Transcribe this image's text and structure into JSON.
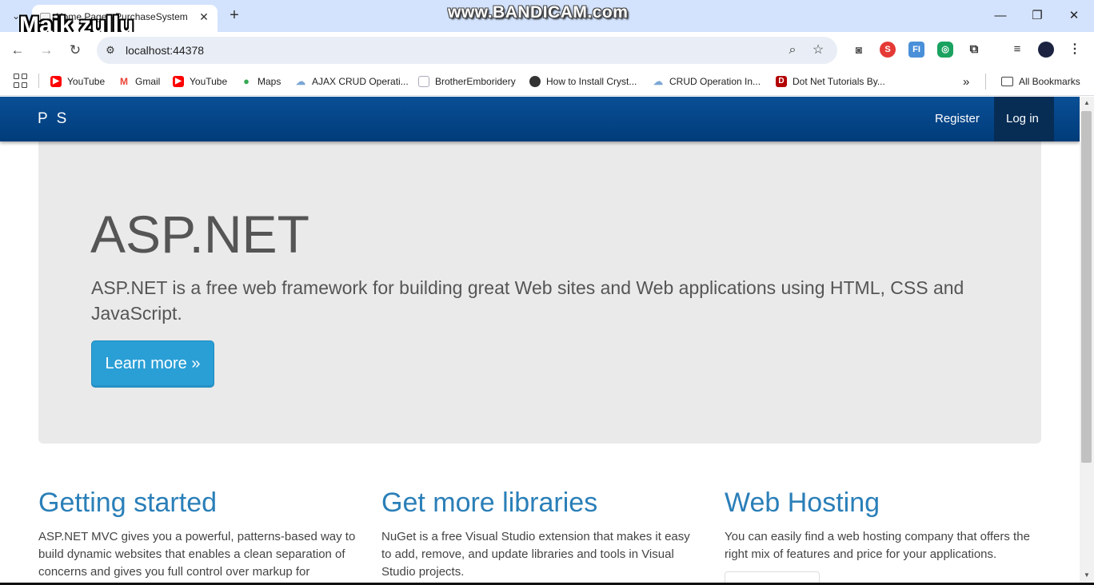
{
  "overlay": {
    "name": "Maik zullu",
    "watermark": "www.BANDICAM.com"
  },
  "browser": {
    "tab_title": "Home Page - PurchaseSystem",
    "url": "localhost:44378",
    "bookmarks": [
      {
        "label": "YouTube",
        "icon": "youtube-icon",
        "color": "#ff0000"
      },
      {
        "label": "Gmail",
        "icon": "gmail-icon",
        "color": "#ea4335"
      },
      {
        "label": "YouTube",
        "icon": "youtube-icon",
        "color": "#ff0000"
      },
      {
        "label": "Maps",
        "icon": "maps-icon",
        "color": "#34a853"
      },
      {
        "label": "AJAX CRUD Operati...",
        "icon": "cloud-icon",
        "color": "#7aa7d6"
      },
      {
        "label": "BrotherEmboridery",
        "icon": "page-icon",
        "color": "#8aa8c8"
      },
      {
        "label": "How to Install Cryst...",
        "icon": "globe-icon",
        "color": "#333333"
      },
      {
        "label": "CRUD Operation In...",
        "icon": "cloud-icon",
        "color": "#7aa7d6"
      },
      {
        "label": "Dot Net Tutorials By...",
        "icon": "dotnet-icon",
        "color": "#b30000"
      }
    ],
    "all_bookmarks": "All Bookmarks"
  },
  "site": {
    "brand": "P S",
    "nav": {
      "register": "Register",
      "login": "Log in"
    },
    "jumbotron": {
      "title": "ASP.NET",
      "lead": "ASP.NET is a free web framework for building great Web sites and Web applications using HTML, CSS and JavaScript.",
      "button": "Learn more »"
    },
    "columns": [
      {
        "title": "Getting started",
        "text": "ASP.NET MVC gives you a powerful, patterns-based way to build dynamic websites that enables a clean separation of concerns and gives you full control over markup for"
      },
      {
        "title": "Get more libraries",
        "text": "NuGet is a free Visual Studio extension that makes it easy to add, remove, and update libraries and tools in Visual Studio projects."
      },
      {
        "title": "Web Hosting",
        "text": "You can easily find a web hosting company that offers the right mix of features and price for your applications."
      }
    ]
  },
  "colors": {
    "navbar": "#003c7a",
    "accent": "#2a9fd6",
    "heading": "#2a7fb8",
    "jumbotron": "#eaeaea"
  }
}
